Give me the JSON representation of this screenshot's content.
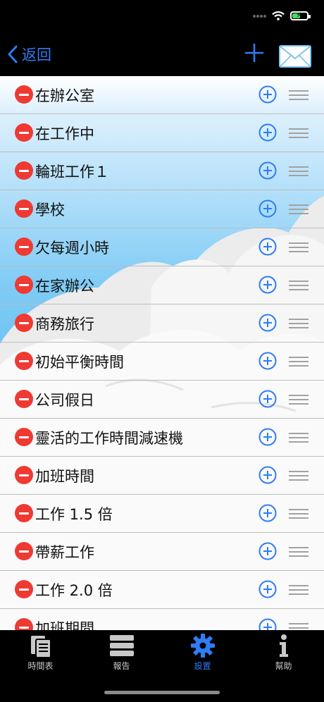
{
  "nav": {
    "back_label": "返回",
    "add_icon": "plus-icon",
    "mail_icon": "envelope-icon"
  },
  "colors": {
    "accent": "#2f7cf6",
    "delete": "#ee3a33",
    "battery": "#4cd964"
  },
  "list": {
    "items": [
      {
        "label": "在辦公室"
      },
      {
        "label": "在工作中"
      },
      {
        "label": "輪班工作１"
      },
      {
        "label": "學校"
      },
      {
        "label": "欠每週小時"
      },
      {
        "label": "在家辦公"
      },
      {
        "label": "商務旅行"
      },
      {
        "label": "初始平衡時間"
      },
      {
        "label": "公司假日"
      },
      {
        "label": "靈活的工作時間減速機"
      },
      {
        "label": "加班時間"
      },
      {
        "label": "工作 1.5 倍"
      },
      {
        "label": "帶薪工作"
      },
      {
        "label": "工作 2.0 倍"
      },
      {
        "label": "加班期間"
      }
    ]
  },
  "tabs": [
    {
      "label": "時間表",
      "icon": "timesheet-icon",
      "active": false
    },
    {
      "label": "報告",
      "icon": "reports-icon",
      "active": false
    },
    {
      "label": "設置",
      "icon": "gear-icon",
      "active": true
    },
    {
      "label": "幫助",
      "icon": "info-icon",
      "active": false
    }
  ]
}
